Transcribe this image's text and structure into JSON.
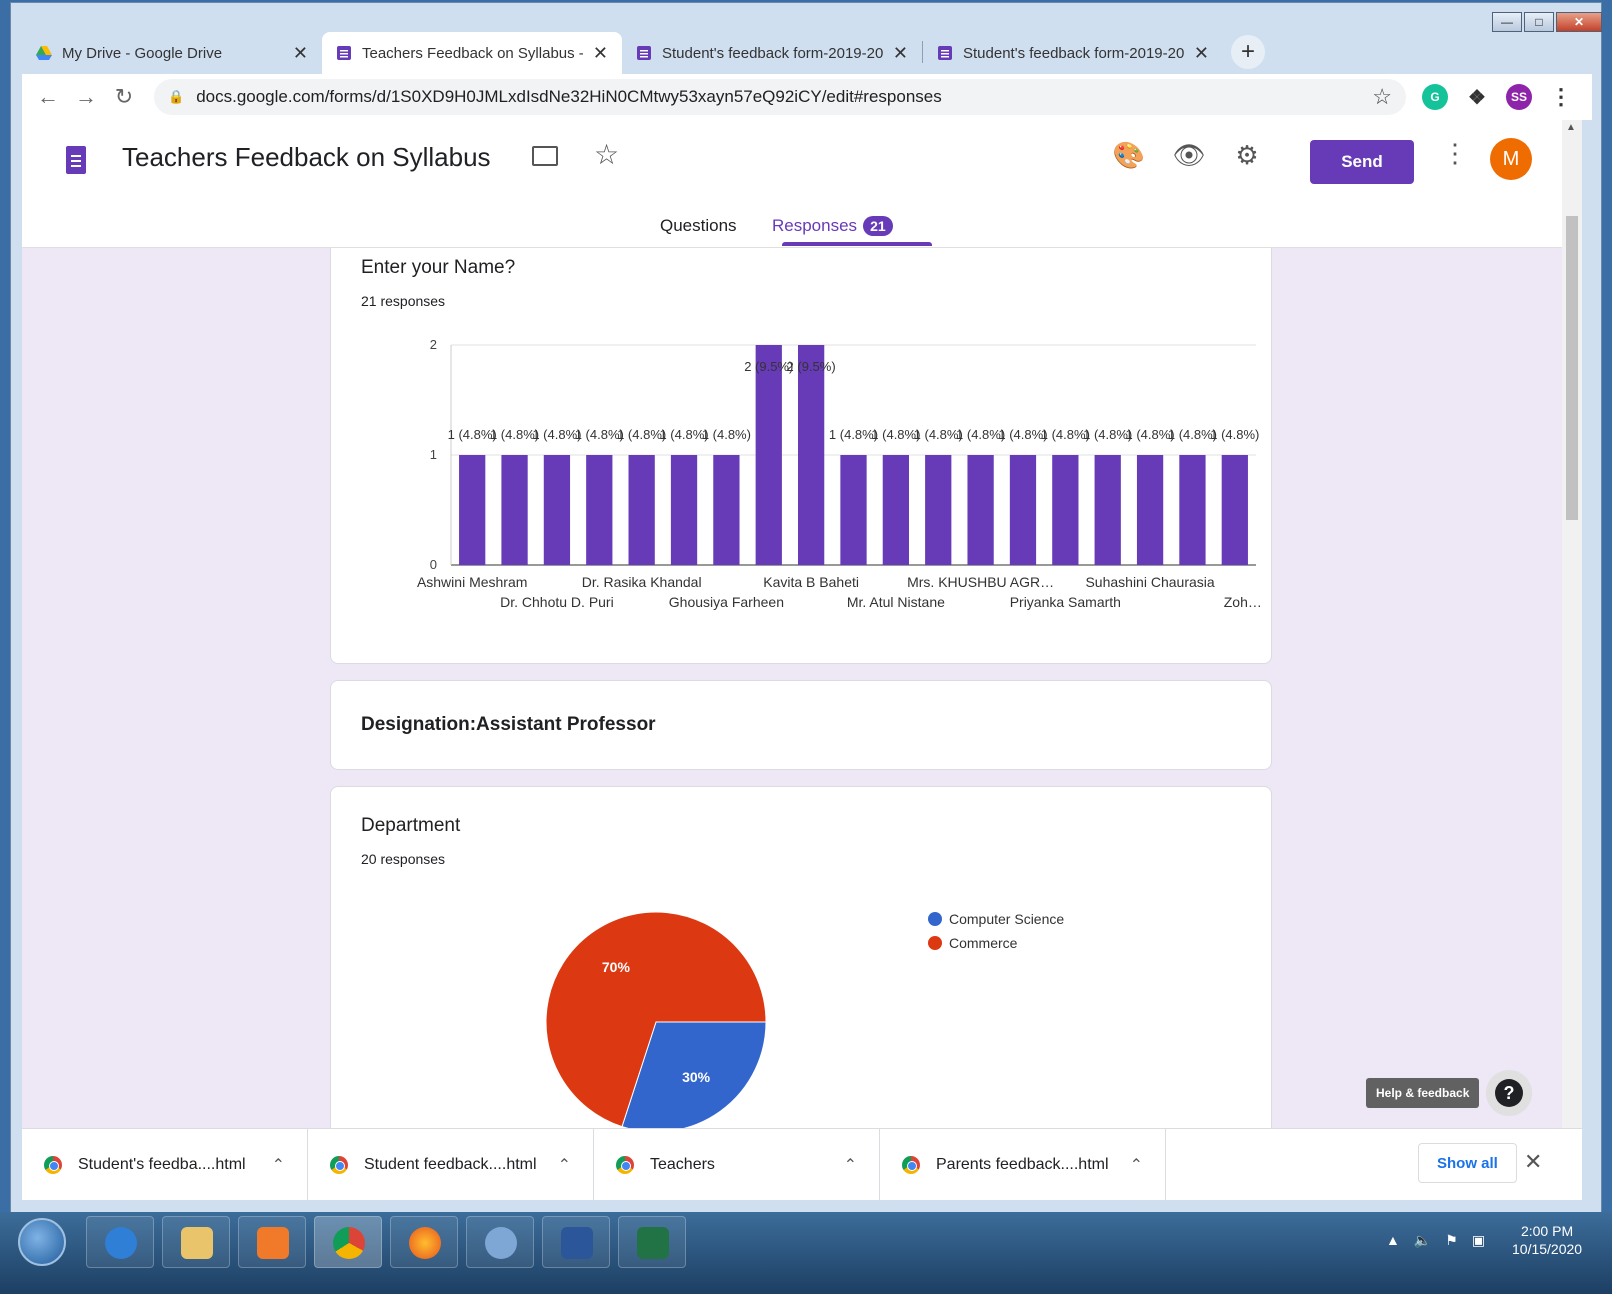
{
  "browser": {
    "tabs": [
      {
        "title": "My Drive - Google Drive",
        "icon": "google-drive-icon"
      },
      {
        "title": "Teachers Feedback on Syllabus -",
        "icon": "google-forms-icon",
        "active": true
      },
      {
        "title": "Student's feedback form-2019-20",
        "icon": "google-forms-icon"
      },
      {
        "title": "Student's feedback form-2019-20",
        "icon": "google-forms-icon"
      }
    ],
    "url": "docs.google.com/forms/d/1S0XD9H0JMLxdIsdNe32HiN0CMtwy53xayn57eQ92iCY/edit#responses",
    "profile_initials": "SS"
  },
  "form": {
    "title": "Teachers Feedback on Syllabus",
    "send_label": "Send",
    "avatar_initial": "M",
    "tab_questions": "Questions",
    "tab_responses": "Responses",
    "responses_count": "21"
  },
  "cards": {
    "name": {
      "title": "Enter your Name?",
      "responses": "21 responses"
    },
    "designation": {
      "title": "Designation:Assistant Professor"
    },
    "department": {
      "title": "Department",
      "responses": "20 responses"
    }
  },
  "chart_data": [
    {
      "type": "bar",
      "title": "",
      "categories": [
        "Ashwini Meshram",
        "Dr. Chhotu D. Puri",
        "Dr. Rasika Khandal",
        "Ghousiya Farheen",
        "Kavita B Baheti",
        "Mr. Atul Nistane",
        "Mrs. KHUSHBU AGR…",
        "Priyanka Samarth",
        "Suhashini Chaurasia",
        "Zoh…"
      ],
      "visible_tick_labels_alternate": true,
      "values": [
        1,
        1,
        1,
        1,
        1,
        1,
        1,
        2,
        2,
        1,
        1,
        1,
        1,
        1,
        1,
        1,
        1,
        1,
        1
      ],
      "data_labels": [
        "1 (4.8%)",
        "1 (4.8%)",
        "1 (4.8%)",
        "1 (4.8%)",
        "1 (4.8%)",
        "1 (4.8%)",
        "1 (4.8%)",
        "2 (9.5%)",
        "2 (9.5%)",
        "1 (4.8%)",
        "1 (4.8%)",
        "1 (4.8%)",
        "1 (4.8%)",
        "1 (4.8%)",
        "1 (4.8%)",
        "1 (4.8%)",
        "1 (4.8%)",
        "1 (4.8%)",
        "1 (4.8%)"
      ],
      "yticks": [
        "0",
        "1",
        "2"
      ],
      "ylim": [
        0,
        2
      ],
      "grid": true,
      "color": "#673ab7"
    },
    {
      "type": "pie",
      "title": "",
      "slices": [
        {
          "name": "Computer Science",
          "value": 30,
          "label": "30%",
          "color": "#3366cc"
        },
        {
          "name": "Commerce",
          "value": 70,
          "label": "70%",
          "color": "#dc3912"
        }
      ],
      "legend": "right"
    }
  ],
  "help": {
    "label": "Help & feedback",
    "glyph": "?"
  },
  "downloads": {
    "items": [
      "Student's feedba....html",
      "Student feedback....html",
      "Teachers",
      "Parents feedback....html"
    ],
    "show_all": "Show all"
  },
  "taskbar": {
    "time": "2:00 PM",
    "date": "10/15/2020"
  }
}
